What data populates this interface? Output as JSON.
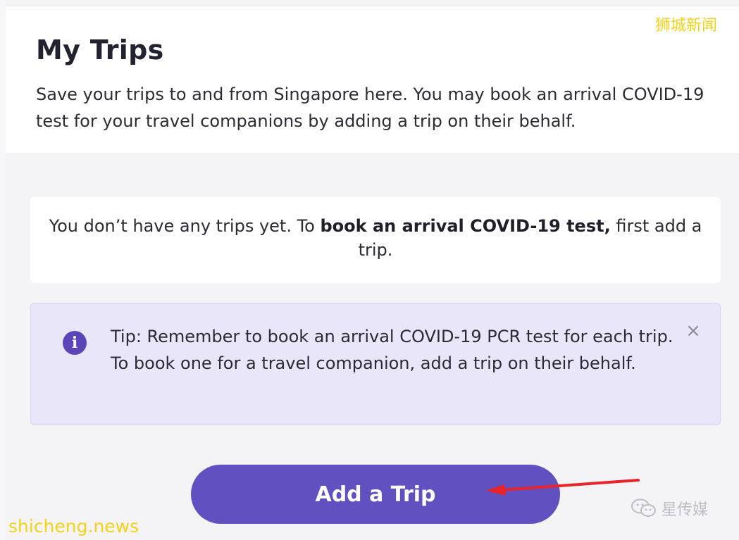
{
  "header": {
    "title": "My Trips",
    "subtitle": "Save your trips to and from Singapore here. You may book an arrival COVID-19 test for your travel companions by adding a trip on their behalf."
  },
  "empty_state": {
    "text_before": "You don’t have any trips yet. To ",
    "text_bold": "book an arrival COVID-19 test,",
    "text_after": " first add a trip."
  },
  "tip": {
    "icon": "info-icon",
    "icon_glyph": "i",
    "text": "Tip: Remember to book an arrival COVID-19 PCR test for each trip. To book one for a travel companion, add a trip on their behalf.",
    "close_glyph": "×"
  },
  "actions": {
    "add_trip_label": "Add a Trip"
  },
  "watermarks": {
    "top_right": "狮城新闻",
    "bottom_left": "shicheng.news",
    "wechat_account": "星传媒"
  },
  "colors": {
    "primary": "#6151c0",
    "tip_background": "#e9e6fa",
    "annotation_arrow": "#e8232a"
  }
}
